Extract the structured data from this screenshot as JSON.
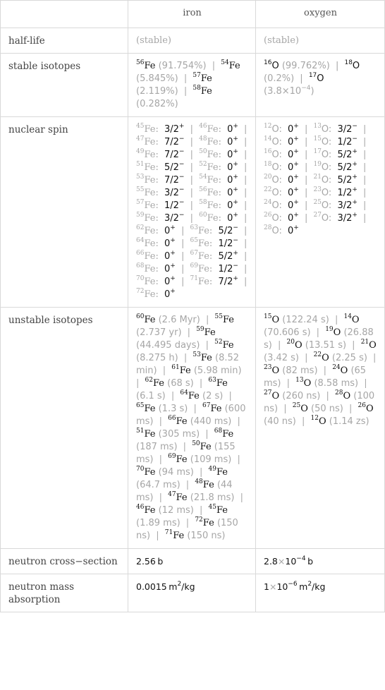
{
  "columns": [
    "",
    "iron",
    "oxygen"
  ],
  "rows": {
    "half_life": {
      "label": "half-life",
      "iron": "(stable)",
      "oxygen": "(stable)"
    },
    "stable_isotopes": {
      "label": "stable isotopes",
      "iron": [
        {
          "mass": "56",
          "symbol": "Fe",
          "value": "(91.754%)"
        },
        {
          "mass": "54",
          "symbol": "Fe",
          "value": "(5.845%)"
        },
        {
          "mass": "57",
          "symbol": "Fe",
          "value": "(2.119%)"
        },
        {
          "mass": "58",
          "symbol": "Fe",
          "value": "(0.282%)"
        }
      ],
      "oxygen": [
        {
          "mass": "16",
          "symbol": "O",
          "value": "(99.762%)"
        },
        {
          "mass": "18",
          "symbol": "O",
          "value": "(0.2%)"
        },
        {
          "mass": "17",
          "symbol": "O",
          "value": "(3.8×10^-4)"
        }
      ]
    },
    "nuclear_spin": {
      "label": "nuclear spin",
      "iron": [
        {
          "mass": "45",
          "symbol": "Fe",
          "spin": "3/2",
          "parity": "+"
        },
        {
          "mass": "46",
          "symbol": "Fe",
          "spin": "0",
          "parity": "+"
        },
        {
          "mass": "47",
          "symbol": "Fe",
          "spin": "7/2",
          "parity": "−"
        },
        {
          "mass": "48",
          "symbol": "Fe",
          "spin": "0",
          "parity": "+"
        },
        {
          "mass": "49",
          "symbol": "Fe",
          "spin": "7/2",
          "parity": "−"
        },
        {
          "mass": "50",
          "symbol": "Fe",
          "spin": "0",
          "parity": "+"
        },
        {
          "mass": "51",
          "symbol": "Fe",
          "spin": "5/2",
          "parity": "−"
        },
        {
          "mass": "52",
          "symbol": "Fe",
          "spin": "0",
          "parity": "+"
        },
        {
          "mass": "53",
          "symbol": "Fe",
          "spin": "7/2",
          "parity": "−"
        },
        {
          "mass": "54",
          "symbol": "Fe",
          "spin": "0",
          "parity": "+"
        },
        {
          "mass": "55",
          "symbol": "Fe",
          "spin": "3/2",
          "parity": "−"
        },
        {
          "mass": "56",
          "symbol": "Fe",
          "spin": "0",
          "parity": "+"
        },
        {
          "mass": "57",
          "symbol": "Fe",
          "spin": "1/2",
          "parity": "−"
        },
        {
          "mass": "58",
          "symbol": "Fe",
          "spin": "0",
          "parity": "+"
        },
        {
          "mass": "59",
          "symbol": "Fe",
          "spin": "3/2",
          "parity": "−"
        },
        {
          "mass": "60",
          "symbol": "Fe",
          "spin": "0",
          "parity": "+"
        },
        {
          "mass": "62",
          "symbol": "Fe",
          "spin": "0",
          "parity": "+"
        },
        {
          "mass": "63",
          "symbol": "Fe",
          "spin": "5/2",
          "parity": "−"
        },
        {
          "mass": "64",
          "symbol": "Fe",
          "spin": "0",
          "parity": "+"
        },
        {
          "mass": "65",
          "symbol": "Fe",
          "spin": "1/2",
          "parity": "−"
        },
        {
          "mass": "66",
          "symbol": "Fe",
          "spin": "0",
          "parity": "+"
        },
        {
          "mass": "67",
          "symbol": "Fe",
          "spin": "5/2",
          "parity": "+"
        },
        {
          "mass": "68",
          "symbol": "Fe",
          "spin": "0",
          "parity": "+"
        },
        {
          "mass": "69",
          "symbol": "Fe",
          "spin": "1/2",
          "parity": "−"
        },
        {
          "mass": "70",
          "symbol": "Fe",
          "spin": "0",
          "parity": "+"
        },
        {
          "mass": "71",
          "symbol": "Fe",
          "spin": "7/2",
          "parity": "+"
        },
        {
          "mass": "72",
          "symbol": "Fe",
          "spin": "0",
          "parity": "+"
        }
      ],
      "oxygen": [
        {
          "mass": "12",
          "symbol": "O",
          "spin": "0",
          "parity": "+"
        },
        {
          "mass": "13",
          "symbol": "O",
          "spin": "3/2",
          "parity": "−"
        },
        {
          "mass": "14",
          "symbol": "O",
          "spin": "0",
          "parity": "+"
        },
        {
          "mass": "15",
          "symbol": "O",
          "spin": "1/2",
          "parity": "−"
        },
        {
          "mass": "16",
          "symbol": "O",
          "spin": "0",
          "parity": "+"
        },
        {
          "mass": "17",
          "symbol": "O",
          "spin": "5/2",
          "parity": "+"
        },
        {
          "mass": "18",
          "symbol": "O",
          "spin": "0",
          "parity": "+"
        },
        {
          "mass": "19",
          "symbol": "O",
          "spin": "5/2",
          "parity": "+"
        },
        {
          "mass": "20",
          "symbol": "O",
          "spin": "0",
          "parity": "+"
        },
        {
          "mass": "21",
          "symbol": "O",
          "spin": "5/2",
          "parity": "+"
        },
        {
          "mass": "22",
          "symbol": "O",
          "spin": "0",
          "parity": "+"
        },
        {
          "mass": "23",
          "symbol": "O",
          "spin": "1/2",
          "parity": "+"
        },
        {
          "mass": "24",
          "symbol": "O",
          "spin": "0",
          "parity": "+"
        },
        {
          "mass": "25",
          "symbol": "O",
          "spin": "3/2",
          "parity": "+"
        },
        {
          "mass": "26",
          "symbol": "O",
          "spin": "0",
          "parity": "+"
        },
        {
          "mass": "27",
          "symbol": "O",
          "spin": "3/2",
          "parity": "+"
        },
        {
          "mass": "28",
          "symbol": "O",
          "spin": "0",
          "parity": "+"
        }
      ]
    },
    "unstable_isotopes": {
      "label": "unstable isotopes",
      "iron": [
        {
          "mass": "60",
          "symbol": "Fe",
          "value": "(2.6 Myr)"
        },
        {
          "mass": "55",
          "symbol": "Fe",
          "value": "(2.737 yr)"
        },
        {
          "mass": "59",
          "symbol": "Fe",
          "value": "(44.495 days)"
        },
        {
          "mass": "52",
          "symbol": "Fe",
          "value": "(8.275 h)"
        },
        {
          "mass": "53",
          "symbol": "Fe",
          "value": "(8.52 min)"
        },
        {
          "mass": "61",
          "symbol": "Fe",
          "value": "(5.98 min)"
        },
        {
          "mass": "62",
          "symbol": "Fe",
          "value": "(68 s)"
        },
        {
          "mass": "63",
          "symbol": "Fe",
          "value": "(6.1 s)"
        },
        {
          "mass": "64",
          "symbol": "Fe",
          "value": "(2 s)"
        },
        {
          "mass": "65",
          "symbol": "Fe",
          "value": "(1.3 s)"
        },
        {
          "mass": "67",
          "symbol": "Fe",
          "value": "(600 ms)"
        },
        {
          "mass": "66",
          "symbol": "Fe",
          "value": "(440 ms)"
        },
        {
          "mass": "51",
          "symbol": "Fe",
          "value": "(305 ms)"
        },
        {
          "mass": "68",
          "symbol": "Fe",
          "value": "(187 ms)"
        },
        {
          "mass": "50",
          "symbol": "Fe",
          "value": "(155 ms)"
        },
        {
          "mass": "69",
          "symbol": "Fe",
          "value": "(109 ms)"
        },
        {
          "mass": "70",
          "symbol": "Fe",
          "value": "(94 ms)"
        },
        {
          "mass": "49",
          "symbol": "Fe",
          "value": "(64.7 ms)"
        },
        {
          "mass": "48",
          "symbol": "Fe",
          "value": "(44 ms)"
        },
        {
          "mass": "47",
          "symbol": "Fe",
          "value": "(21.8 ms)"
        },
        {
          "mass": "46",
          "symbol": "Fe",
          "value": "(12 ms)"
        },
        {
          "mass": "45",
          "symbol": "Fe",
          "value": "(1.89 ms)"
        },
        {
          "mass": "72",
          "symbol": "Fe",
          "value": "(150 ns)"
        },
        {
          "mass": "71",
          "symbol": "Fe",
          "value": "(150 ns)"
        }
      ],
      "oxygen": [
        {
          "mass": "15",
          "symbol": "O",
          "value": "(122.24 s)"
        },
        {
          "mass": "14",
          "symbol": "O",
          "value": "(70.606 s)"
        },
        {
          "mass": "19",
          "symbol": "O",
          "value": "(26.88 s)"
        },
        {
          "mass": "20",
          "symbol": "O",
          "value": "(13.51 s)"
        },
        {
          "mass": "21",
          "symbol": "O",
          "value": "(3.42 s)"
        },
        {
          "mass": "22",
          "symbol": "O",
          "value": "(2.25 s)"
        },
        {
          "mass": "23",
          "symbol": "O",
          "value": "(82 ms)"
        },
        {
          "mass": "24",
          "symbol": "O",
          "value": "(65 ms)"
        },
        {
          "mass": "13",
          "symbol": "O",
          "value": "(8.58 ms)"
        },
        {
          "mass": "27",
          "symbol": "O",
          "value": "(260 ns)"
        },
        {
          "mass": "28",
          "symbol": "O",
          "value": "(100 ns)"
        },
        {
          "mass": "25",
          "symbol": "O",
          "value": "(50 ns)"
        },
        {
          "mass": "26",
          "symbol": "O",
          "value": "(40 ns)"
        },
        {
          "mass": "12",
          "symbol": "O",
          "value": "(1.14 zs)"
        }
      ]
    },
    "neutron_cross_section": {
      "label": "neutron cross−section",
      "iron": {
        "mantissa": "2.56",
        "exponent": "",
        "unit": "b"
      },
      "oxygen": {
        "mantissa": "2.8",
        "exponent": "−4",
        "unit": "b"
      }
    },
    "neutron_mass_absorption": {
      "label": "neutron mass absorption",
      "iron": {
        "mantissa": "0.0015",
        "exponent": "",
        "unit": "m",
        "unit_power": "2",
        "unit_tail": "/kg"
      },
      "oxygen": {
        "mantissa": "1",
        "exponent": "−6",
        "unit": "m",
        "unit_power": "2",
        "unit_tail": "/kg"
      }
    }
  }
}
